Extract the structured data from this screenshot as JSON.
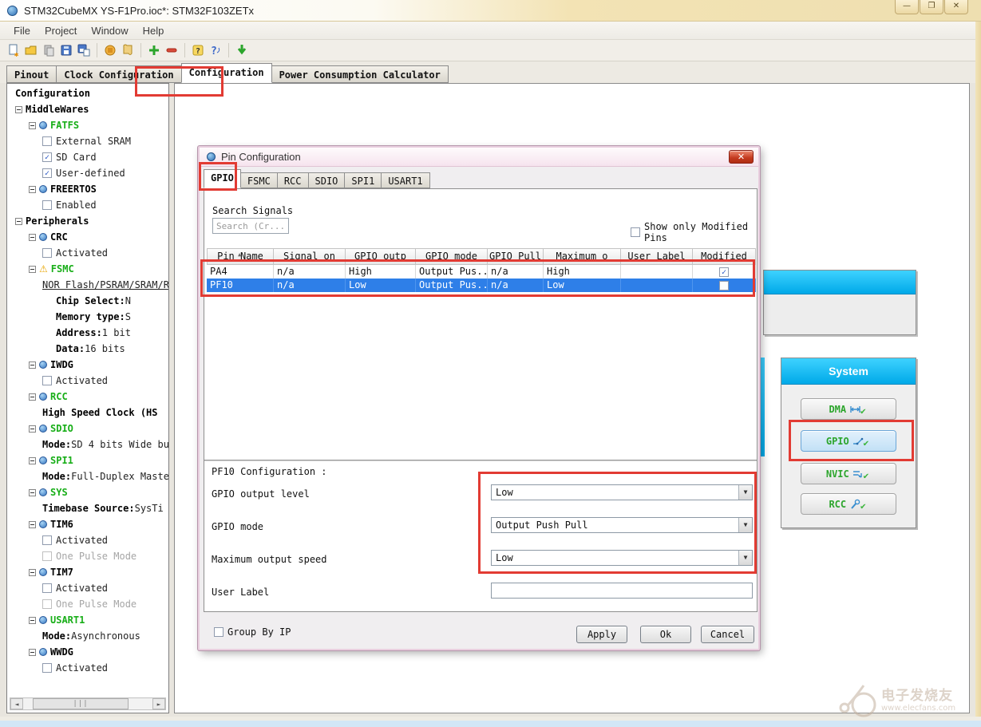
{
  "window": {
    "title": "STM32CubeMX YS-F1Pro.ioc*: STM32F103ZETx",
    "caption_buttons": [
      "minimize",
      "maximize",
      "close"
    ]
  },
  "icons": {
    "minimize": "—",
    "maximize": "❐",
    "close": "✕",
    "dropdown": "▼",
    "sort_asc": "▲",
    "check": "✓",
    "scroll_left": "◄",
    "scroll_right": "►",
    "thumb_grip": "|||",
    "warning": "⚠"
  },
  "menu": {
    "items": [
      "File",
      "Project",
      "Window",
      "Help"
    ]
  },
  "toolbar": {
    "icons": [
      "new-file",
      "open-folder",
      "copy",
      "save",
      "save-all",
      "chip",
      "report",
      "add",
      "remove",
      "help",
      "context-help",
      "download"
    ]
  },
  "main_tabs": {
    "active": "Configuration",
    "items": [
      "Pinout",
      "Clock Configuration",
      "Configuration",
      "Power Consumption Calculator"
    ]
  },
  "tree": {
    "items": [
      {
        "text": "Configuration",
        "level": 0,
        "kind": "root"
      },
      {
        "text": "MiddleWares",
        "level": 0,
        "kind": "group"
      },
      {
        "text": "FATFS",
        "level": 1,
        "kind": "node",
        "icon": "dot",
        "color": "green"
      },
      {
        "text": "External SRAM",
        "level": 2,
        "kind": "check",
        "checked": false
      },
      {
        "text": "SD Card",
        "level": 2,
        "kind": "check",
        "checked": true
      },
      {
        "text": "User-defined",
        "level": 2,
        "kind": "check",
        "checked": true
      },
      {
        "text": "FREERTOS",
        "level": 1,
        "kind": "node",
        "icon": "dot",
        "color": "black"
      },
      {
        "text": "Enabled",
        "level": 2,
        "kind": "check",
        "checked": false
      },
      {
        "text": "Peripherals",
        "level": 0,
        "kind": "group"
      },
      {
        "text": "CRC",
        "level": 1,
        "kind": "node",
        "icon": "dot",
        "color": "black"
      },
      {
        "text": "Activated",
        "level": 2,
        "kind": "check",
        "checked": false
      },
      {
        "text": "FSMC",
        "level": 1,
        "kind": "node",
        "icon": "warn",
        "color": "green"
      },
      {
        "text": "NOR Flash/PSRAM/SRAM/RO",
        "level": 2,
        "kind": "link"
      },
      {
        "text": "Chip Select",
        "level": 3,
        "kind": "prop",
        "value": "N"
      },
      {
        "text": "Memory type",
        "level": 3,
        "kind": "prop",
        "value": "S"
      },
      {
        "text": "Address",
        "level": 3,
        "kind": "prop",
        "value": "1 bit"
      },
      {
        "text": "Data",
        "level": 3,
        "kind": "prop",
        "value": "16 bits"
      },
      {
        "text": "IWDG",
        "level": 1,
        "kind": "node",
        "icon": "dot",
        "color": "black"
      },
      {
        "text": "Activated",
        "level": 2,
        "kind": "check",
        "checked": false
      },
      {
        "text": "RCC",
        "level": 1,
        "kind": "node",
        "icon": "dot",
        "color": "green"
      },
      {
        "text": "High Speed Clock  (HS",
        "level": 2,
        "kind": "boldprop"
      },
      {
        "text": "SDIO",
        "level": 1,
        "kind": "node",
        "icon": "dot",
        "color": "green"
      },
      {
        "text": "Mode",
        "level": 2,
        "kind": "prop",
        "value": "SD 4 bits Wide bu"
      },
      {
        "text": "SPI1",
        "level": 1,
        "kind": "node",
        "icon": "dot",
        "color": "green"
      },
      {
        "text": "Mode",
        "level": 2,
        "kind": "prop",
        "value": "Full-Duplex Maste"
      },
      {
        "text": "SYS",
        "level": 1,
        "kind": "node",
        "icon": "dot",
        "color": "green"
      },
      {
        "text": "Timebase Source",
        "level": 2,
        "kind": "prop",
        "value": "SysTi"
      },
      {
        "text": "TIM6",
        "level": 1,
        "kind": "node",
        "icon": "dot",
        "color": "black"
      },
      {
        "text": "Activated",
        "level": 2,
        "kind": "check",
        "checked": false
      },
      {
        "text": "One Pulse Mode",
        "level": 2,
        "kind": "check",
        "checked": false,
        "disabled": true
      },
      {
        "text": "TIM7",
        "level": 1,
        "kind": "node",
        "icon": "dot",
        "color": "black"
      },
      {
        "text": "Activated",
        "level": 2,
        "kind": "check",
        "checked": false
      },
      {
        "text": "One Pulse Mode",
        "level": 2,
        "kind": "check",
        "checked": false,
        "disabled": true
      },
      {
        "text": "USART1",
        "level": 1,
        "kind": "node",
        "icon": "dot",
        "color": "green"
      },
      {
        "text": "Mode",
        "level": 2,
        "kind": "prop",
        "value": "Asynchronous"
      },
      {
        "text": "WWDG",
        "level": 1,
        "kind": "node",
        "icon": "dot",
        "color": "black"
      },
      {
        "text": "Activated",
        "level": 2,
        "kind": "check",
        "checked": false
      }
    ]
  },
  "dialog": {
    "title": "Pin Configuration",
    "tabs": [
      "GPIO",
      "FSMC",
      "RCC",
      "SDIO",
      "SPI1",
      "USART1"
    ],
    "active_tab": "GPIO",
    "search_label": "Search Signals",
    "search_placeholder": "Search (Cr...",
    "show_only_label": "Show only Modified Pins",
    "table": {
      "columns": [
        "Pin Name",
        "Signal on",
        "GPIO outp",
        "GPIO mode",
        "GPIO Pull",
        "Maximum o",
        "User Label",
        "Modified"
      ],
      "rows": [
        {
          "cells": [
            "PA4",
            "n/a",
            "High",
            "Output Pus...",
            "n/a",
            "High",
            ""
          ],
          "modified": true,
          "selected": false
        },
        {
          "cells": [
            "PF10",
            "n/a",
            "Low",
            "Output Pus...",
            "n/a",
            "Low",
            ""
          ],
          "modified": false,
          "selected": true
        }
      ]
    },
    "config": {
      "title": "PF10 Configuration :",
      "fields": [
        {
          "label": "GPIO output level",
          "value": "Low",
          "type": "select"
        },
        {
          "label": "GPIO mode",
          "value": "Output Push Pull",
          "type": "select"
        },
        {
          "label": "Maximum output speed",
          "value": "Low",
          "type": "select"
        },
        {
          "label": "User Label",
          "value": "",
          "type": "text"
        }
      ]
    },
    "footer": {
      "group_by_ip": "Group By IP",
      "apply": "Apply",
      "ok": "Ok",
      "cancel": "Cancel"
    }
  },
  "side_panel": {
    "title": "System",
    "buttons": [
      {
        "label": "DMA",
        "selected": false
      },
      {
        "label": "GPIO",
        "selected": true
      },
      {
        "label": "NVIC",
        "selected": false
      },
      {
        "label": "RCC",
        "selected": false
      }
    ]
  },
  "watermark": {
    "line1": "电子发烧友",
    "line2": "www.elecfans.com"
  },
  "colors": {
    "accent_cyan": "#00b2ee",
    "selection_blue": "#2e7fe8",
    "annotation_red": "#e23b33",
    "peripheral_green": "#18ae18",
    "titlebar_tan": "#eedfb0"
  }
}
